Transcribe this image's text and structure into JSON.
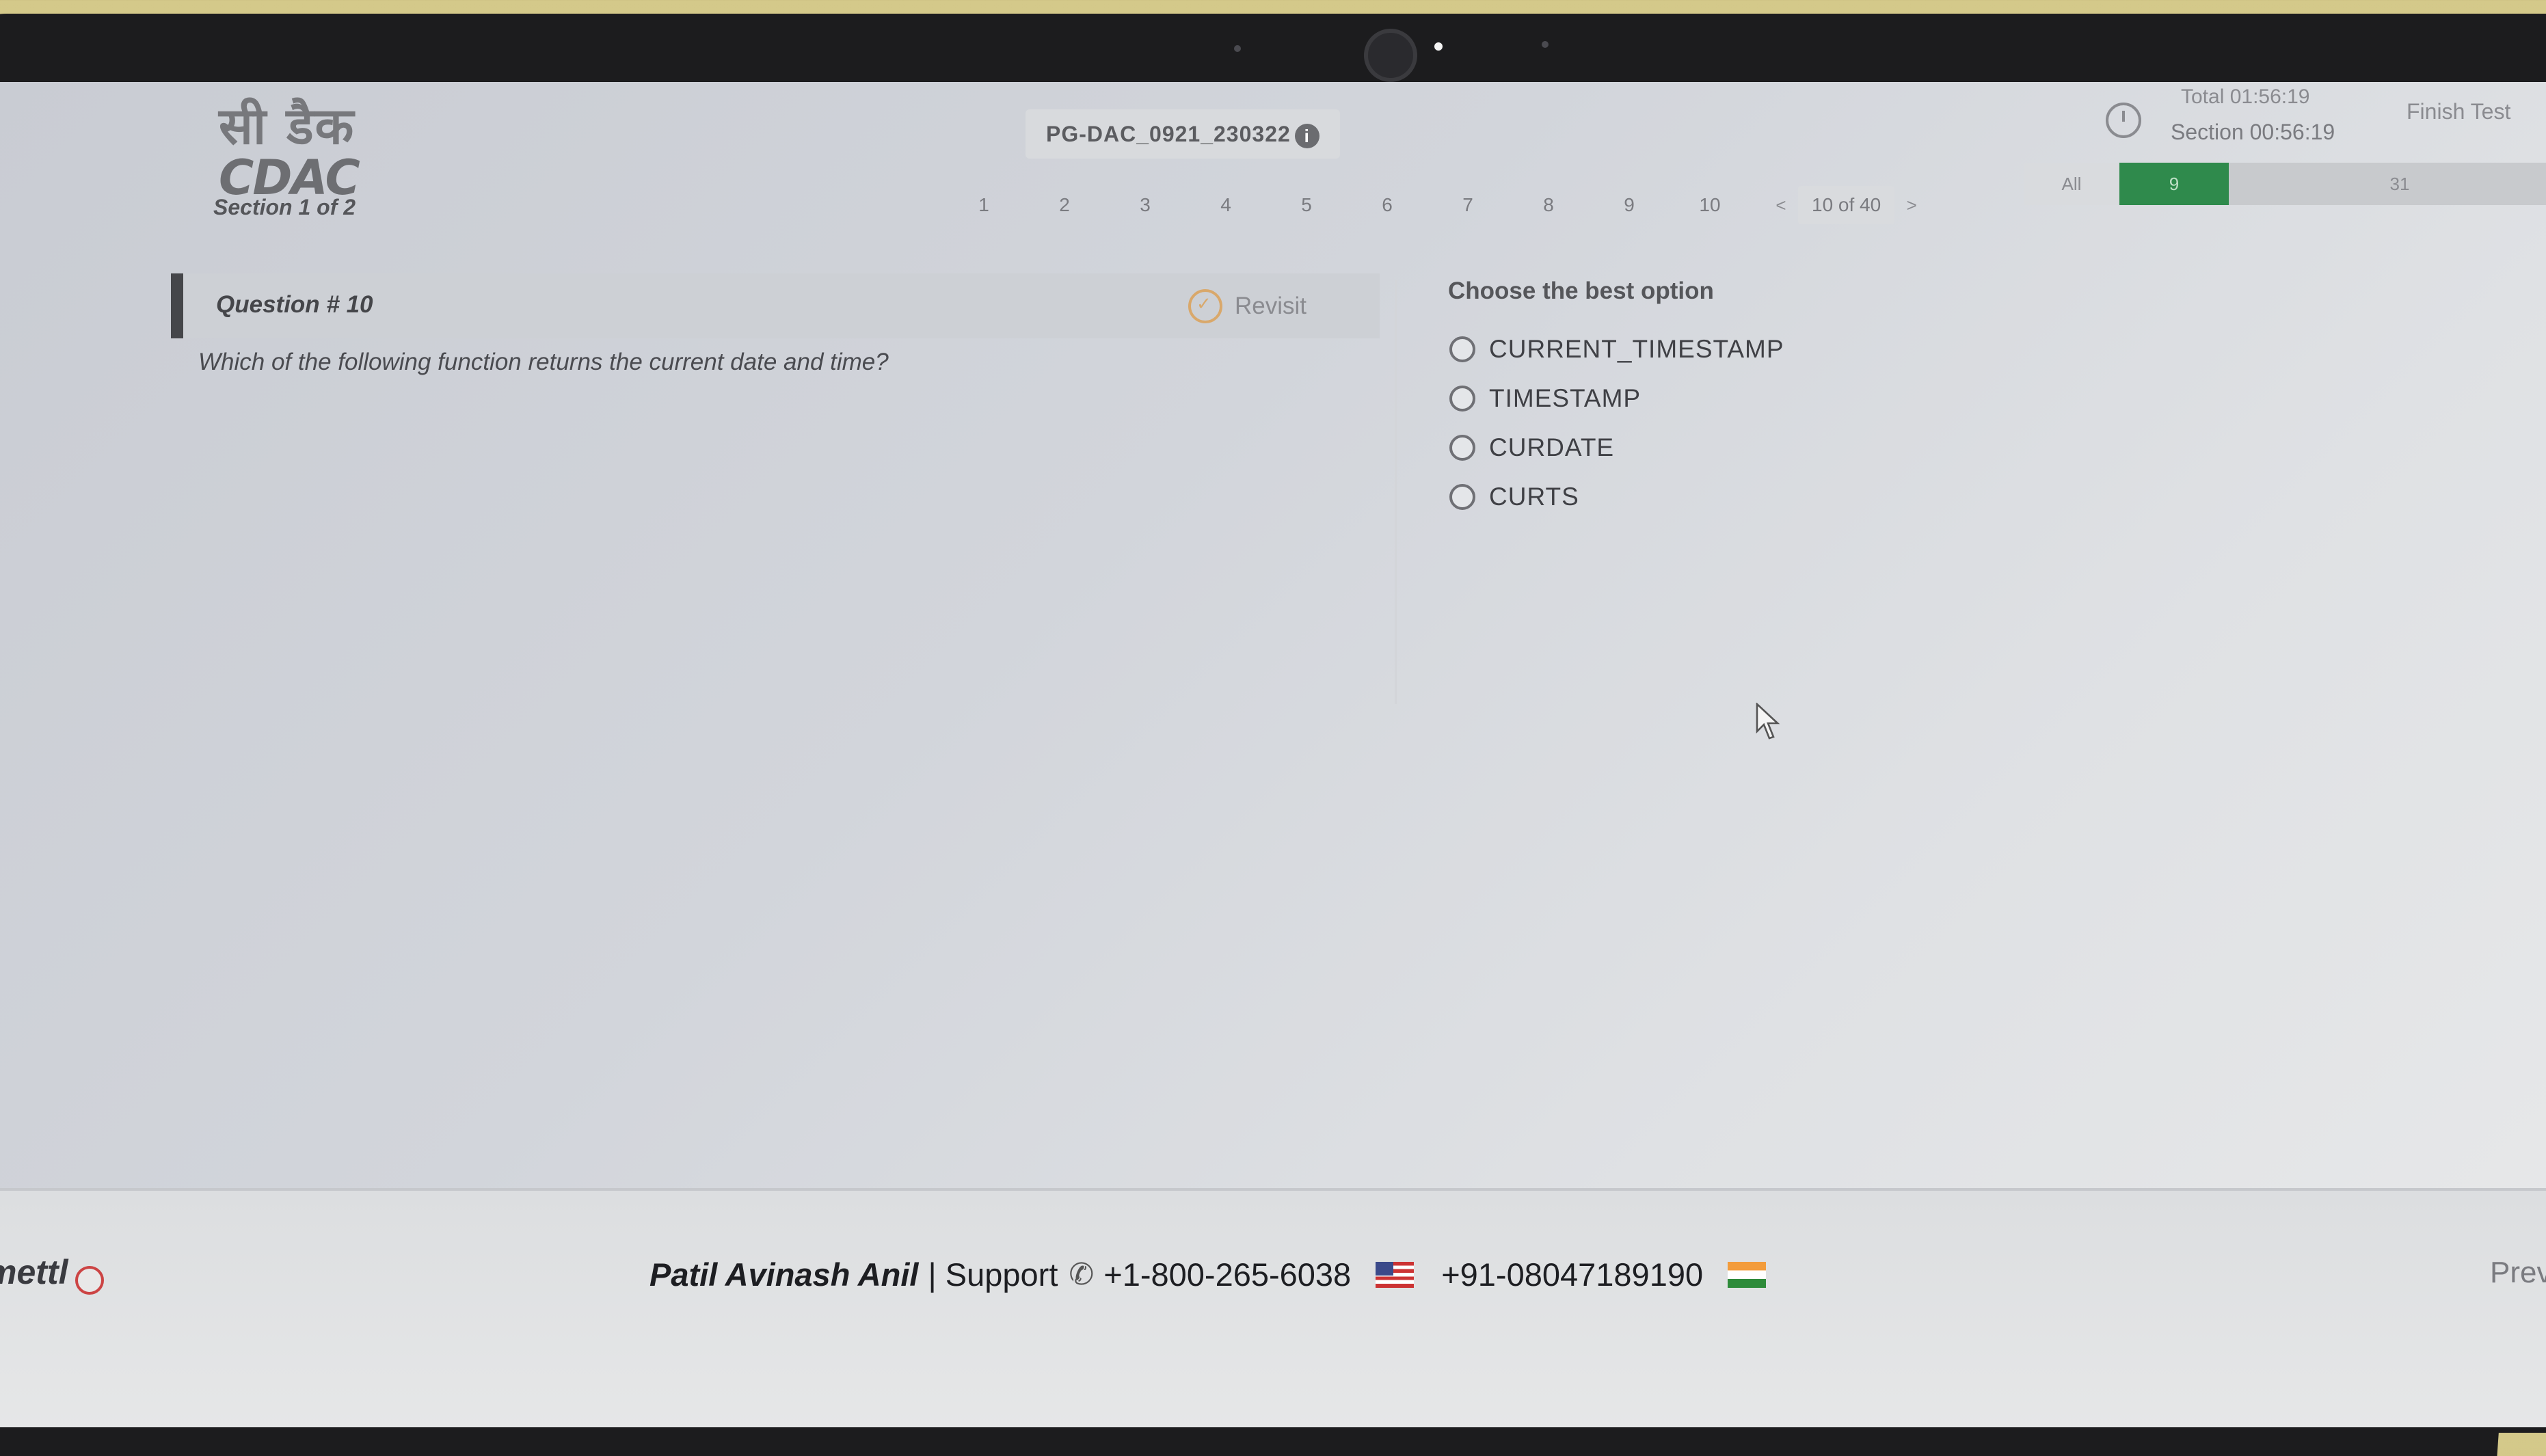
{
  "header": {
    "logo_hindi": "सी डैक",
    "logo_text": "CDAC",
    "section_label": "Section 1 of 2",
    "exam_code": "PG-DAC_0921_230322",
    "question_nav": [
      "1",
      "2",
      "3",
      "4",
      "5",
      "6",
      "7",
      "8",
      "9",
      "10"
    ],
    "pager_prev": "<",
    "pager_text": "10 of 40",
    "pager_next": ">",
    "timer_total": "Total 01:56:19",
    "timer_section": "Section 00:56:19",
    "finish_label": "Finish Test",
    "filter_all": "All",
    "filter_answered": "9",
    "filter_remaining": "31"
  },
  "question": {
    "number_label": "Question # 10",
    "revisit_label": "Revisit",
    "text": "Which of the following function returns the current date and time?"
  },
  "answers": {
    "heading": "Choose the best option",
    "options": [
      "CURRENT_TIMESTAMP",
      "TIMESTAMP",
      "CURDATE",
      "CURTS"
    ]
  },
  "footer": {
    "brand": "mettl",
    "candidate": "Patil Avinash Anil",
    "support_label": "| Support",
    "phone_us": "+1-800-265-6038",
    "phone_in": "+91-08047189190",
    "prev_label": "Prev"
  },
  "colors": {
    "accent_green": "#2f8a4c",
    "revisit_orange": "#d9a86b"
  }
}
